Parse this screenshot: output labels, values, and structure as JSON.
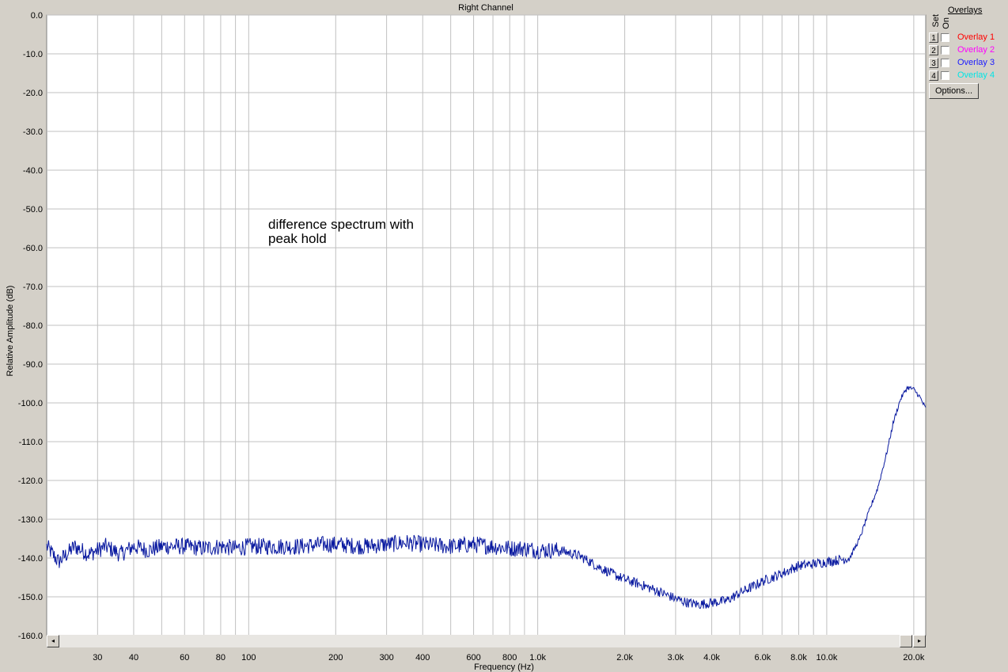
{
  "chart_data": {
    "type": "line",
    "title": "Right Channel",
    "xlabel": "Frequency (Hz)",
    "ylabel": "Relative Amplitude (dB)",
    "annotation": [
      "difference spectrum with",
      "peak hold"
    ],
    "x_scale": "log",
    "xlim": [
      20,
      22000
    ],
    "ylim": [
      -160,
      0
    ],
    "y_ticks": [
      "0.0",
      "-10.0",
      "-20.0",
      "-30.0",
      "-40.0",
      "-50.0",
      "-60.0",
      "-70.0",
      "-80.0",
      "-90.0",
      "-100.0",
      "-110.0",
      "-120.0",
      "-130.0",
      "-140.0",
      "-150.0",
      "-160.0"
    ],
    "x_tick_labels": [
      {
        "f": 30,
        "label": "30"
      },
      {
        "f": 40,
        "label": "40"
      },
      {
        "f": 60,
        "label": "60"
      },
      {
        "f": 80,
        "label": "80"
      },
      {
        "f": 100,
        "label": "100"
      },
      {
        "f": 200,
        "label": "200"
      },
      {
        "f": 300,
        "label": "300"
      },
      {
        "f": 400,
        "label": "400"
      },
      {
        "f": 600,
        "label": "600"
      },
      {
        "f": 800,
        "label": "800"
      },
      {
        "f": 1000,
        "label": "1.0k"
      },
      {
        "f": 2000,
        "label": "2.0k"
      },
      {
        "f": 3000,
        "label": "3.0k"
      },
      {
        "f": 4000,
        "label": "4.0k"
      },
      {
        "f": 6000,
        "label": "6.0k"
      },
      {
        "f": 8000,
        "label": "8.0k"
      },
      {
        "f": 10000,
        "label": "10.0k"
      },
      {
        "f": 20000,
        "label": "20.0k"
      }
    ],
    "grid": true,
    "series": [
      {
        "color": "#0a1aa0",
        "x": [
          20,
          22,
          25,
          28,
          32,
          36,
          40,
          45,
          50,
          60,
          70,
          80,
          90,
          100,
          120,
          150,
          180,
          200,
          250,
          300,
          350,
          400,
          500,
          600,
          700,
          800,
          900,
          1000,
          1200,
          1400,
          1600,
          1800,
          2000,
          2300,
          2600,
          3000,
          3300,
          3600,
          4000,
          4500,
          5000,
          5500,
          6000,
          7000,
          8000,
          9000,
          10000,
          11000,
          12000,
          13000,
          14000,
          15000,
          16000,
          17000,
          18000,
          19000,
          20000,
          21000,
          22000
        ],
        "y": [
          -137,
          -141,
          -137,
          -139,
          -137,
          -139,
          -137,
          -138,
          -137,
          -137,
          -137.5,
          -137,
          -137.5,
          -137,
          -137,
          -137,
          -136.5,
          -136.5,
          -137,
          -136.5,
          -136,
          -136.5,
          -137,
          -136.5,
          -137,
          -137.5,
          -137.5,
          -138,
          -138,
          -139.5,
          -142,
          -144,
          -145.5,
          -147,
          -148.5,
          -150.5,
          -151.5,
          -152,
          -151.5,
          -151,
          -149,
          -147.5,
          -146,
          -144,
          -142,
          -141.5,
          -141,
          -140.5,
          -140,
          -135,
          -128,
          -122,
          -114,
          -105,
          -99,
          -96,
          -96.5,
          -98.5,
          -101.5
        ]
      }
    ]
  },
  "overlays": {
    "title": "Overlays",
    "set_label": "Set",
    "on_label": "On",
    "items": [
      {
        "num": "1",
        "name": "Overlay 1",
        "color": "#ff0000"
      },
      {
        "num": "2",
        "name": "Overlay 2",
        "color": "#ff00ff"
      },
      {
        "num": "3",
        "name": "Overlay 3",
        "color": "#1a1aff"
      },
      {
        "num": "4",
        "name": "Overlay 4",
        "color": "#00e5e5"
      }
    ],
    "options_label": "Options..."
  },
  "scrollbar": {
    "left_arrow": "◂",
    "right_arrow": "▸"
  }
}
